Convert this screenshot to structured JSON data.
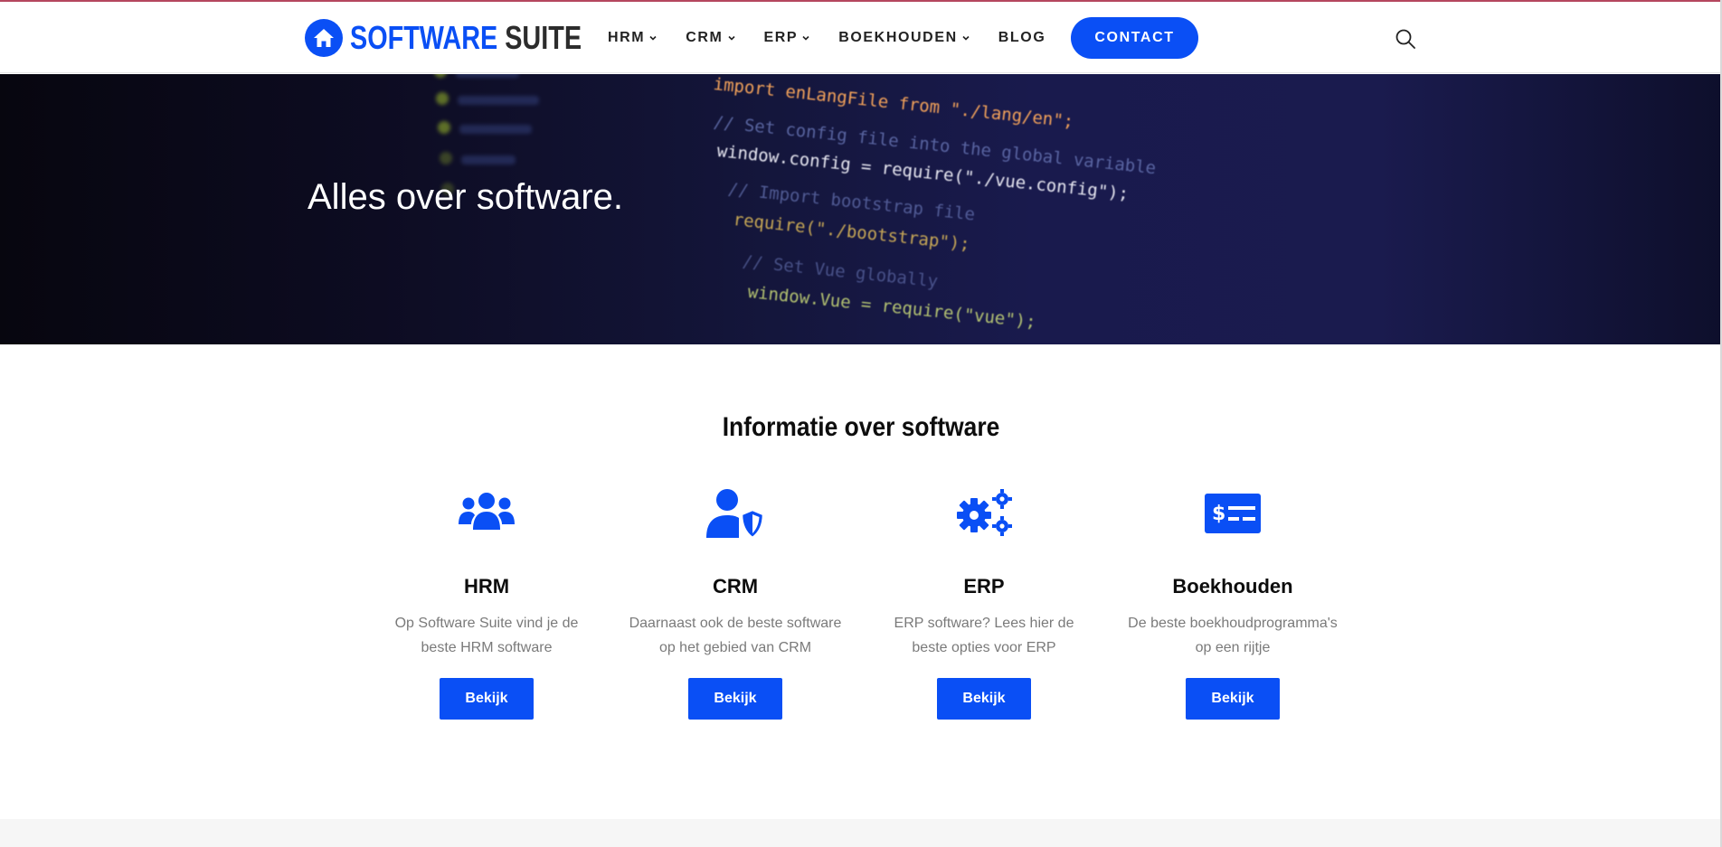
{
  "header": {
    "logo": {
      "word1": "SOFTWARE",
      "word2": "SUITE"
    },
    "nav": [
      {
        "label": "HRM",
        "has_dropdown": true
      },
      {
        "label": "CRM",
        "has_dropdown": true
      },
      {
        "label": "ERP",
        "has_dropdown": true
      },
      {
        "label": "BOEKHOUDEN",
        "has_dropdown": true
      },
      {
        "label": "BLOG",
        "has_dropdown": false
      }
    ],
    "contact_label": "CONTACT",
    "search_icon": "search-icon"
  },
  "hero": {
    "title": "Alles over software.",
    "code_lines": [
      "import enLangFile from \"./lang/en\";",
      "// Set config file into the global variable",
      "window.config = require(\"./vue.config\");",
      "// Import bootstrap file",
      "require(\"./bootstrap\");",
      "// Set Vue globally",
      "window.Vue = require(\"vue\");"
    ]
  },
  "section": {
    "title": "Informatie over software",
    "cards": [
      {
        "icon": "users-icon",
        "title": "HRM",
        "text": "Op Software Suite vind je de beste HRM software",
        "button": "Bekijk"
      },
      {
        "icon": "user-shield-icon",
        "title": "CRM",
        "text": "Daarnaast ook de beste software op het gebied van CRM",
        "button": "Bekijk"
      },
      {
        "icon": "cogs-icon",
        "title": "ERP",
        "text": "ERP software? Lees hier de beste opties voor ERP",
        "button": "Bekijk"
      },
      {
        "icon": "money-check-icon",
        "title": "Boekhouden",
        "text": "De beste boekhoudprogramma's op een rijtje",
        "button": "Bekijk"
      }
    ]
  },
  "colors": {
    "accent": "#0a4ff5",
    "text_dark": "#0d0d0d",
    "text_muted": "#7a7a7a"
  }
}
